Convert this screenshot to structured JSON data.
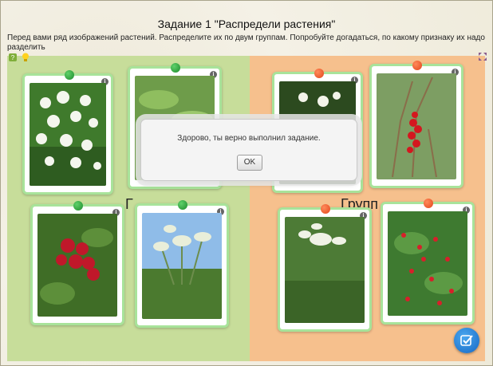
{
  "header": {
    "title": "Задание 1 \"Распредели растения\"",
    "description": "Перед вами ряд изображений растений. Распределите их по двум группам. Попробуйте догадаться, по какому признаку их надо разделить"
  },
  "toolbar": {
    "help_icon": "help-icon",
    "hint_icon": "lightbulb-icon",
    "expand_icon": "expand-icon"
  },
  "groups": {
    "left_label": "Г",
    "right_label": "Групп"
  },
  "cards": {
    "info_label": "i"
  },
  "dialog": {
    "message": "Здорово, ты верно выполнил задание.",
    "ok_label": "OK"
  },
  "colors": {
    "left_zone": "#c7dd9a",
    "right_zone": "#f6c08d",
    "card_border": "#a8e39a",
    "pin_green": "#1d8a2c",
    "pin_red": "#e2451b",
    "check_button": "#1668c4"
  }
}
